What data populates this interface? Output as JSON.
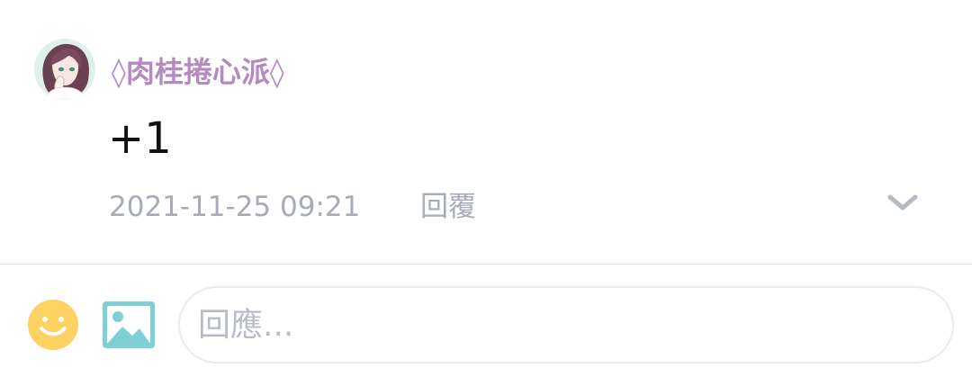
{
  "comment": {
    "username": "◊肉桂捲心派◊",
    "text": "+1",
    "timestamp": "2021-11-25 09:21",
    "reply_label": "回覆"
  },
  "composer": {
    "placeholder": "回應..."
  },
  "colors": {
    "username": "#b58ac0",
    "meta_text": "#a7abb6",
    "emoji_icon": "#fdd162",
    "image_icon": "#7fcfd6",
    "divider": "#e6e6e9"
  },
  "icons": {
    "expand": "chevron-down-icon",
    "emoji": "smiley-face-icon",
    "image": "image-icon"
  }
}
